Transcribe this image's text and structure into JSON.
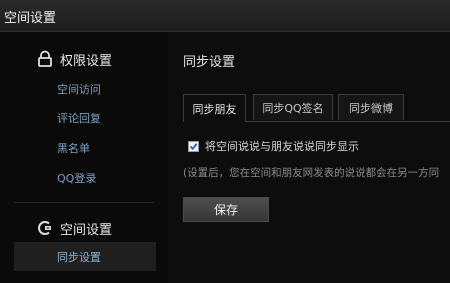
{
  "window": {
    "title": "空间设置"
  },
  "sidebar": {
    "section1": {
      "label": "权限设置",
      "icon": "lock-icon"
    },
    "links": [
      "空间访问",
      "评论回复",
      "黑名单",
      "QQ登录"
    ],
    "section2": {
      "label": "空间设置",
      "icon": "qzone-icon"
    },
    "active_item": "同步设置"
  },
  "main": {
    "title": "同步设置",
    "tabs": [
      "同步朋友",
      "同步QQ签名",
      "同步微博"
    ],
    "active_tab_index": 0,
    "checkbox": {
      "label": "将空间说说与朋友说说同步显示",
      "checked": true
    },
    "hint": "(设置后，您在空间和朋友网发表的说说都会在另一方同",
    "save_label": "保存"
  },
  "colors": {
    "link": "#7fa2c2",
    "active_bg": "#1f1f1f",
    "background": "#0d0d0d"
  }
}
